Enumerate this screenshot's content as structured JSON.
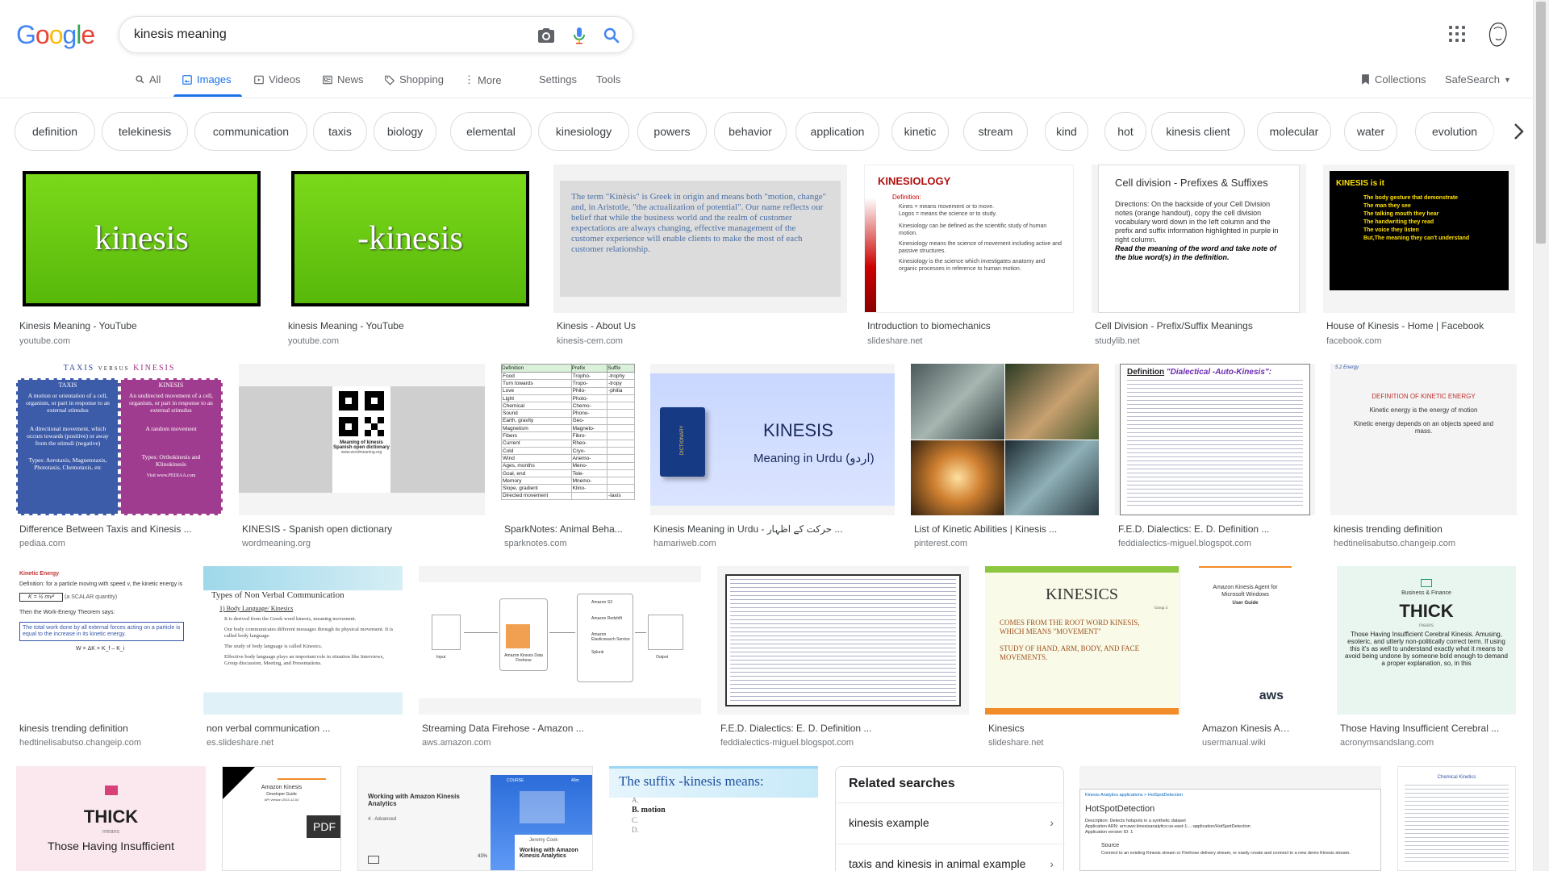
{
  "header": {
    "logo_letters": [
      "G",
      "o",
      "o",
      "g",
      "l",
      "e"
    ],
    "logo_colors": [
      "#4285f4",
      "#ea4335",
      "#fbbc05",
      "#4285f4",
      "#34a853",
      "#ea4335"
    ],
    "search_value": "kinesis meaning"
  },
  "tabs": {
    "all": "All",
    "images": "Images",
    "videos": "Videos",
    "news": "News",
    "shopping": "Shopping",
    "more": "More",
    "settings": "Settings",
    "tools": "Tools",
    "collections": "Collections",
    "safesearch": "SafeSearch"
  },
  "chips": [
    "definition",
    "telekinesis",
    "communication",
    "taxis",
    "biology",
    "elemental",
    "kinesiology",
    "powers",
    "behavior",
    "application",
    "kinetic",
    "stream",
    "kind",
    "hot",
    "kinesis client",
    "molecular",
    "water",
    "evolution"
  ],
  "results": {
    "r1": {
      "title": "Kinesis Meaning - YouTube",
      "source": "youtube.com",
      "text": "kinesis"
    },
    "r2": {
      "title": "kinesis Meaning - YouTube",
      "source": "youtube.com",
      "text": "-kinesis"
    },
    "r3": {
      "title": "Kinesis - About Us",
      "source": "kinesis-cem.com",
      "text": "The term \"Kinèsis\" is Greek in origin and means both \"motion, change\" and, in Aristotle, \"the actualization of potential\". Our name reflects our belief that while the business world and the realm of customer expectations are always changing, effective management of the customer experience will enable clients to make the most of each customer relationship."
    },
    "r4": {
      "title": "Introduction to biomechanics",
      "source": "slideshare.net",
      "heading": "KINESIOLOGY",
      "def_label": "Definition:",
      "lines": [
        "Kines = means movement or to move.",
        "Logos = means the science or to study.",
        "Kinesiology can be defined as the scientific study of human motion.",
        "Kinesiology means the science of movement including active and passive structures.",
        "Kinesiology is the science which investigates anatomy and organic processes in reference to human motion."
      ]
    },
    "r5": {
      "title": "Cell Division - Prefix/Suffix Meanings",
      "source": "studylib.net",
      "heading": "Cell division - Prefixes & Suffixes",
      "body": "Directions: On the backside of your Cell Division notes (orange handout), copy the cell division vocabulary word down in the left column and the prefix and suffix information highlighted in purple in right column.",
      "emphasis": "Read the meaning of the word and take note of the blue word(s) in the definition."
    },
    "r6": {
      "title": "House of Kinesis - Home | Facebook",
      "source": "facebook.com",
      "heading": "KINESIS is it",
      "lines": [
        "The body gesture that demonstrate",
        "The man they see",
        "The talking mouth they hear",
        "The handwriting they read",
        "The voice they listen",
        "But,The meaning they can't understand"
      ]
    },
    "r7": {
      "title": "Difference Between Taxis and Kinesis ...",
      "source": "pediaa.com",
      "heading_left": "TAXIS",
      "versus": "VERSUS",
      "heading_right": "KINESIS",
      "left_def": "A motion or orientation of a cell, organism, or part in response to an external stimulus",
      "right_def": "An undirected movement of a cell, organism, or part in response to an external stimulus",
      "left_type": "A directional movement, which occurs towards (positive) or away from the stimuli (negative)",
      "right_type": "A random movement",
      "left_ex": "Types: Aerotaxis, Magnetotaxis, Phototaxis, Chemotaxis, etc",
      "right_ex": "Types: Orthokinesis and Klinokinesis",
      "credit": "Visit www.PEDIAA.com"
    },
    "r8": {
      "title": "KINESIS - Spanish open dictionary",
      "source": "wordmeaning.org",
      "caption": "Meaning of kinesis",
      "caption2": "Spanish open dictionary",
      "url": "www.wordmeaning.org"
    },
    "r9": {
      "title": "SparkNotes: Animal Beha...",
      "source": "sparknotes.com",
      "headers": [
        "Definition",
        "Prefix",
        "Suffix"
      ],
      "rows": [
        [
          "Food",
          "Tropho-",
          "-trophy"
        ],
        [
          "Turn towards",
          "Tropo-",
          "-tropy"
        ],
        [
          "Love",
          "Philo-",
          "-philia"
        ],
        [
          "Light",
          "Photo-",
          ""
        ],
        [
          "Chemical",
          "Chemo-",
          ""
        ],
        [
          "Sound",
          "Phono-",
          ""
        ],
        [
          "Earth, gravity",
          "Geo-",
          ""
        ],
        [
          "Magnetism",
          "Magneto-",
          ""
        ],
        [
          "Fibers",
          "Fibro-",
          ""
        ],
        [
          "Current",
          "Rheo-",
          ""
        ],
        [
          "Cold",
          "Cryo-",
          ""
        ],
        [
          "Wind",
          "Anemo-",
          ""
        ],
        [
          "Ages, months",
          "Meno-",
          ""
        ],
        [
          "Goal, end",
          "Tele-",
          ""
        ],
        [
          "Memory",
          "Mnemo-",
          ""
        ],
        [
          "Slope, gradient",
          "Klino-",
          ""
        ],
        [
          "Directed movement",
          "",
          "-taxis"
        ]
      ]
    },
    "r10": {
      "title": "Kinesis Meaning in Urdu - حرکت کے اظہار ...",
      "source": "hamariweb.com",
      "heading": "KINESIS",
      "sub": "Meaning in Urdu (اردو)",
      "book": "DICTIONARY"
    },
    "r11": {
      "title": "List of Kinetic Abilities | Kinesis ...",
      "source": "pinterest.com"
    },
    "r12": {
      "title": "F.E.D. Dialectics: E. D. Definition ...",
      "source": "feddialectics-miguel.blogspot.com",
      "heading_a": "Definition",
      "heading_b": "\"Dialectical -Auto-Kinesis\":"
    },
    "r13": {
      "title": "kinesis trending definition",
      "source": "hedtinelisabutso.changeip.com",
      "corner": "5.2 Energy",
      "heading": "DEFINITION OF KINETIC ENERGY",
      "line1": "Kinetic energy is the energy of motion",
      "line2": "Kinetic energy depends on an objects speed and mass."
    },
    "r14": {
      "title": "kinesis trending definition",
      "source": "hedtinelisabutso.changeip.com",
      "heading": "Kinetic Energy",
      "def": "Definition: for a particle moving with speed v, the kinetic energy is",
      "formula": "K = ½ mv²",
      "scalar": "(a SCALAR quantity)",
      "theorem": "Then the Work-Energy Theorem says:",
      "box": "The total work done by all external forces acting on a particle is equal to the increase in its kinetic energy.",
      "eq": "W = ΔK = K_f – K_i"
    },
    "r15": {
      "title": "non verbal communication ...",
      "source": "es.slideshare.net",
      "heading": "Types of Non Verbal Communication",
      "sub": "1) Body Language/ Kinesics",
      "bullets": [
        "It is derived from the Greek word kinesis, meaning movement.",
        "Our body communicates different messages through its physical movement. It is called body language.",
        "The study of body language is called Kinesics.",
        "Effective body language plays an important role in situation like Interviews, Group discussion, Meeting, and Presentations."
      ]
    },
    "r16": {
      "title": "Streaming Data Firehose - Amazon ...",
      "source": "aws.amazon.com",
      "labels": [
        "Input",
        "Amazon Kinesis Data Firehose",
        "Amazon S3",
        "Amazon Redshift",
        "Amazon Elasticsearch Service",
        "Splunk",
        "Output"
      ]
    },
    "r17": {
      "title": "F.E.D. Dialectics: E. D. Definition ...",
      "source": "feddialectics-miguel.blogspot.com"
    },
    "r18": {
      "title": "Kinesics",
      "source": "slideshare.net",
      "heading": "KINESICS",
      "group": "Group 4",
      "line1": "COMES FROM THE ROOT WORD KINESIS, WHICH MEANS \"MOVEMENT\"",
      "line2": "STUDY OF HAND, ARM, BODY, AND FACE MOVEMENTS."
    },
    "r19": {
      "title": "Amazon Kinesis Agent ...",
      "source": "usermanual.wiki",
      "heading": "Amazon Kinesis Agent for Microsoft Windows",
      "sub": "User Guide",
      "brand": "aws"
    },
    "r20": {
      "title": "Those Having Insufficient Cerebral ...",
      "source": "acronymsandslang.com",
      "category": "Business & Finance",
      "word": "THICK",
      "means": "means",
      "body": "Those Having Insufficient Cerebral Kinesis. Amusing, esoteric, and utterly non-politically correct term. If using this it's as well to understand exactly what it means to avoid being undone by someone bold enough to demand a proper explanation, so, in this"
    },
    "r21": {
      "word": "THICK",
      "means": "means",
      "body": "Those Having Insufficient"
    },
    "r22": {
      "heading": "Amazon Kinesis",
      "sub": "Developer Guide",
      "ver": "API Version 2013-12-02",
      "badge": "PDF"
    },
    "r23": {
      "heading": "Working with Amazon Kinesis Analytics",
      "meta": "4 · Advanced",
      "course": "COURSE",
      "dur": "40m",
      "author": "Jeremy Cook",
      "progress": "43%",
      "title2": "Working with Amazon Kinesis Analytics"
    },
    "r24": {
      "heading": "The suffix -kinesis means:",
      "a": "A.",
      "b": "B. motion",
      "c": "C.",
      "d": "D."
    },
    "r25": {
      "crumb": "Kinesis Analytics applications > HotSpotDetection",
      "heading": "HotSpotDetection",
      "desc": "Description: Detects hotspots in a synthetic dataset",
      "arn": "Application ARN: arn:aws:kinesisanalytics:us-east-1:...:application/HotSpotDetection",
      "version": "Application version ID: 1",
      "source": "Source",
      "src_desc": "Connect to an existing Kinesis stream or Firehose delivery stream, or easily create and connect to a new demo Kinesis stream."
    },
    "r26": {
      "heading": "Chemical Kinetics"
    }
  },
  "related": {
    "heading": "Related searches",
    "items": [
      "kinesis example",
      "taxis and kinesis in animal example"
    ]
  }
}
